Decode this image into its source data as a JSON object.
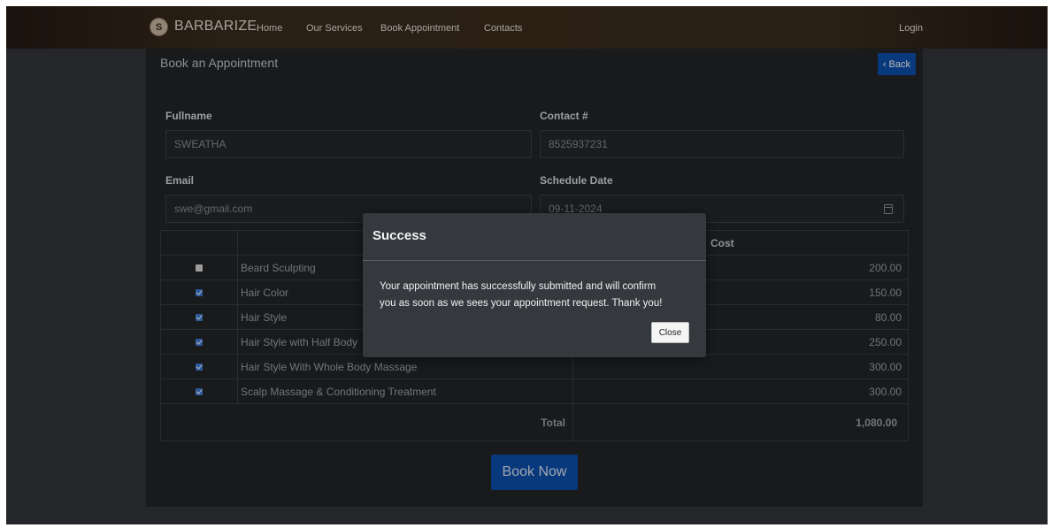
{
  "nav": {
    "logo_letter": "S",
    "brand": "BARBARIZE",
    "links": [
      "Home",
      "Our Services",
      "Book Appointment",
      "Contacts"
    ],
    "login": "Login"
  },
  "page": {
    "title": "Book an Appointment",
    "back_label": "‹ Back"
  },
  "form": {
    "fullname_label": "Fullname",
    "fullname_value": "SWEATHA",
    "contact_label": "Contact #",
    "contact_value": "8525937231",
    "email_label": "Email",
    "email_value": "swe@gmail.com",
    "date_label": "Schedule Date",
    "date_value": "09-11-2024"
  },
  "services": {
    "cost_header": "Cost",
    "rows": [
      {
        "name": "Beard Sculpting",
        "cost": "200.00",
        "checked": false
      },
      {
        "name": "Hair Color",
        "cost": "150.00",
        "checked": true
      },
      {
        "name": "Hair Style",
        "cost": "80.00",
        "checked": true
      },
      {
        "name": "Hair Style with Half Body",
        "cost": "250.00",
        "checked": true
      },
      {
        "name": "Hair Style With Whole Body Massage",
        "cost": "300.00",
        "checked": true
      },
      {
        "name": "Scalp Massage & Conditioning Treatment",
        "cost": "300.00",
        "checked": true
      }
    ],
    "total_label": "Total",
    "total_value": "1,080.00"
  },
  "book_label": "Book Now",
  "modal": {
    "title": "Success",
    "message_line1": "Your appointment has successfully submitted and will confirm",
    "message_line2": "you as soon as we sees your appointment request. Thank you!",
    "close_label": "Close"
  }
}
